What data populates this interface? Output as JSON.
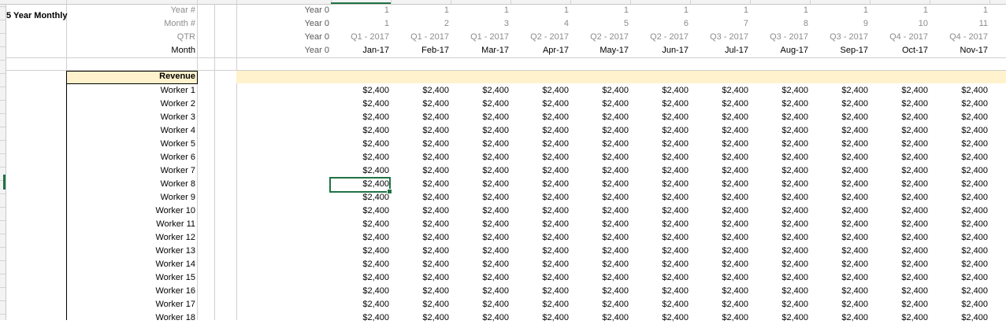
{
  "sheet_title": "5 Year Monthly",
  "header_labels": {
    "year": "Year #",
    "month": "Month #",
    "qtr": "QTR",
    "month_name": "Month"
  },
  "year0_values": [
    "Year 0",
    "Year 0",
    "Year 0",
    "Year 0"
  ],
  "columns": [
    {
      "year": "1",
      "month": "1",
      "qtr": "Q1 - 2017",
      "month_name": "Jan-17"
    },
    {
      "year": "1",
      "month": "2",
      "qtr": "Q1 - 2017",
      "month_name": "Feb-17"
    },
    {
      "year": "1",
      "month": "3",
      "qtr": "Q1 - 2017",
      "month_name": "Mar-17"
    },
    {
      "year": "1",
      "month": "4",
      "qtr": "Q2 - 2017",
      "month_name": "Apr-17"
    },
    {
      "year": "1",
      "month": "5",
      "qtr": "Q2 - 2017",
      "month_name": "May-17"
    },
    {
      "year": "1",
      "month": "6",
      "qtr": "Q2 - 2017",
      "month_name": "Jun-17"
    },
    {
      "year": "1",
      "month": "7",
      "qtr": "Q3 - 2017",
      "month_name": "Jul-17"
    },
    {
      "year": "1",
      "month": "8",
      "qtr": "Q3 - 2017",
      "month_name": "Aug-17"
    },
    {
      "year": "1",
      "month": "9",
      "qtr": "Q3 - 2017",
      "month_name": "Sep-17"
    },
    {
      "year": "1",
      "month": "10",
      "qtr": "Q4 - 2017",
      "month_name": "Oct-17"
    },
    {
      "year": "1",
      "month": "11",
      "qtr": "Q4 - 2017",
      "month_name": "Nov-17"
    }
  ],
  "revenue_label": "Revenue",
  "workers": [
    "Worker 1",
    "Worker 2",
    "Worker 3",
    "Worker 4",
    "Worker 5",
    "Worker 6",
    "Worker 7",
    "Worker 8",
    "Worker 9",
    "Worker 10",
    "Worker 11",
    "Worker 12",
    "Worker 13",
    "Worker 14",
    "Worker 15",
    "Worker 16",
    "Worker 17",
    "Worker 18"
  ],
  "cell_value": "$2,400",
  "selected_cell": {
    "worker": "Worker 8",
    "month": "Jan-17"
  },
  "colors": {
    "revenue_band": "#fff2cc",
    "selection": "#217346",
    "muted_text": "#8c8c8c"
  }
}
